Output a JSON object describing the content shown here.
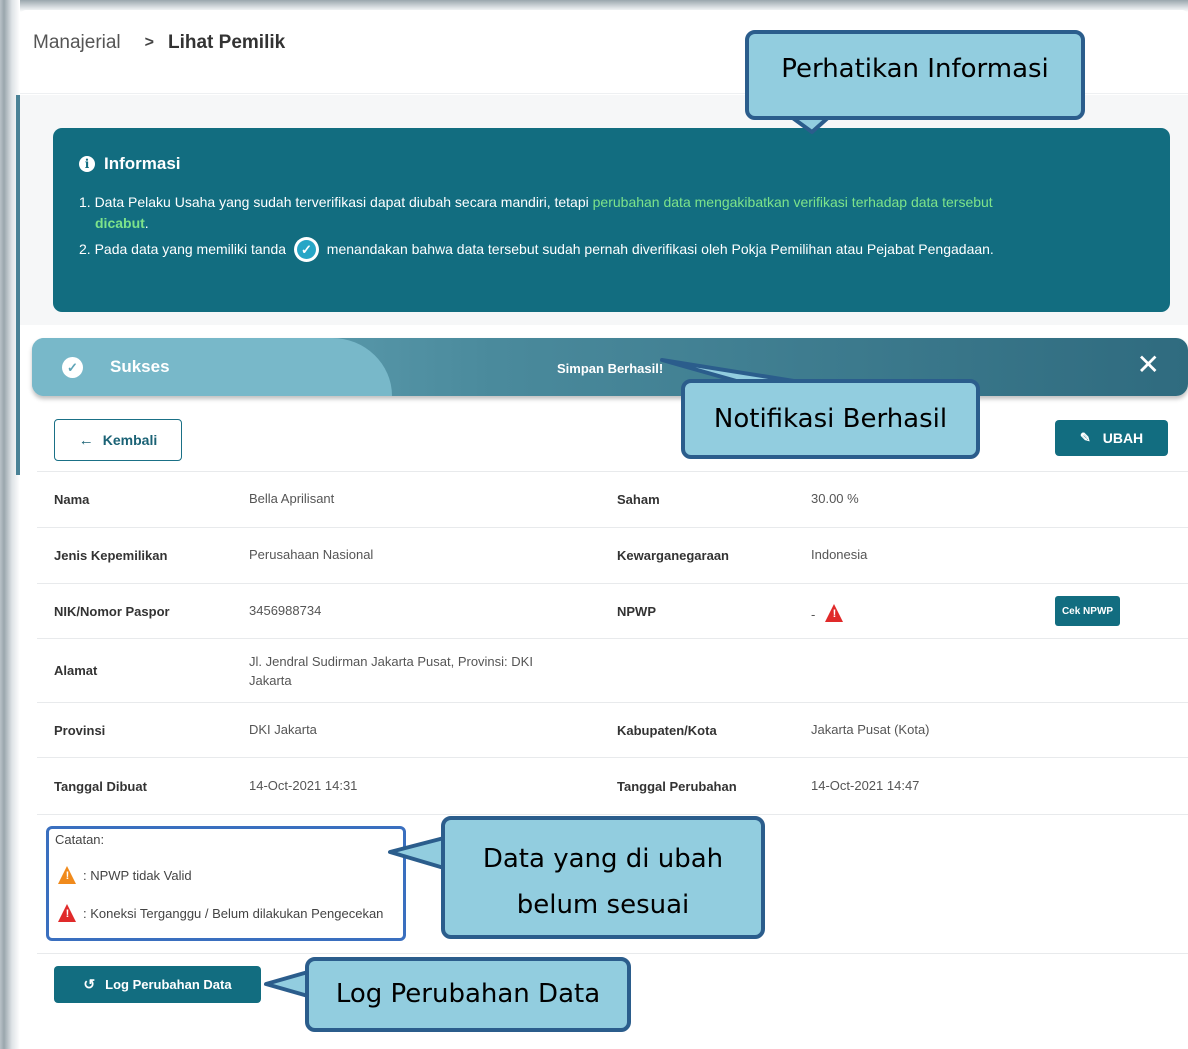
{
  "breadcrumb": {
    "parent": "Manajerial",
    "separator": ">",
    "current": "Lihat Pemilik"
  },
  "info": {
    "title": "Informasi",
    "item1_prefix": "1. Data Pelaku Usaha yang sudah terverifikasi dapat diubah secara mandiri, tetapi ",
    "item1_highlight": "perubahan data mengakibatkan verifikasi terhadap data tersebut",
    "item1_bold": "dicabut",
    "item1_suffix": ".",
    "item2_prefix": "2. Pada data yang memiliki tanda",
    "item2_suffix": "menandakan bahwa data tersebut sudah pernah diverifikasi oleh Pokja Pemilihan atau Pejabat Pengadaan."
  },
  "success": {
    "label": "Sukses",
    "message": "Simpan Berhasil!"
  },
  "buttons": {
    "back": "Kembali",
    "edit": "UBAH",
    "cek_npwp": "Cek NPWP",
    "log": "Log Perubahan Data"
  },
  "details": {
    "nama_label": "Nama",
    "nama": "Bella Aprilisant",
    "saham_label": "Saham",
    "saham": "30.00 %",
    "jenis_label": "Jenis Kepemilikan",
    "jenis": "Perusahaan Nasional",
    "kewarganegaraan_label": "Kewarganegaraan",
    "kewarganegaraan": "Indonesia",
    "nik_label": "NIK/Nomor Paspor",
    "nik": "3456988734",
    "npwp_label": "NPWP",
    "npwp": "-",
    "alamat_label": "Alamat",
    "alamat": "Jl. Jendral Sudirman Jakarta Pusat, Provinsi: DKI Jakarta",
    "provinsi_label": "Provinsi",
    "provinsi": "DKI Jakarta",
    "kabupaten_label": "Kabupaten/Kota",
    "kabupaten": "Jakarta Pusat (Kota)",
    "dibuat_label": "Tanggal Dibuat",
    "dibuat": "14-Oct-2021 14:31",
    "perubahan_label": "Tanggal Perubahan",
    "perubahan": "14-Oct-2021 14:47"
  },
  "notes": {
    "title": "Catatan:",
    "warning_orange": ": NPWP tidak Valid",
    "warning_red": ": Koneksi Terganggu / Belum dilakukan Pengecekan"
  },
  "callouts": {
    "info": "Perhatikan Informasi",
    "success": "Notifikasi Berhasil",
    "notes_line1": "Data yang di ubah",
    "notes_line2": "belum sesuai",
    "log": "Log Perubahan Data"
  },
  "colors": {
    "primary": "#126d80",
    "highlight": "#7de38a",
    "warning_red": "#e02a2a",
    "warning_orange": "#f08a1c",
    "callout_fill": "#92cddf",
    "callout_border": "#2b5d8c"
  }
}
